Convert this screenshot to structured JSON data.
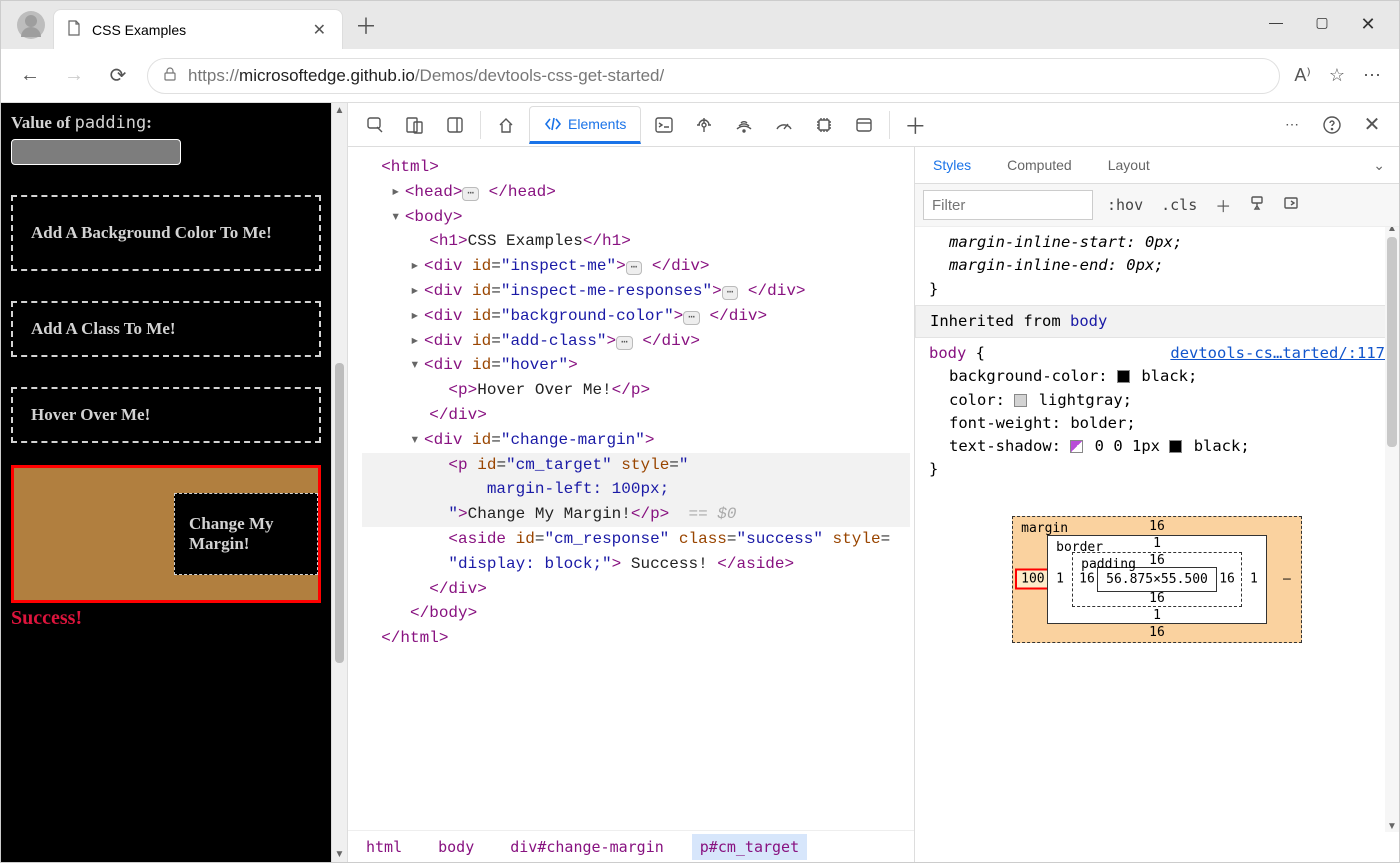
{
  "browser": {
    "tab_title": "CSS Examples",
    "url_prefix": "https://",
    "url_host": "microsoftedge.github.io",
    "url_path": "/Demos/devtools-css-get-started/"
  },
  "page": {
    "padding_label_prefix": "Value of ",
    "padding_label_mono": "padding",
    "padding_label_suffix": ":",
    "box_bgcolor": "Add A Background Color To Me!",
    "box_addclass": "Add A Class To Me!",
    "box_hover": "Hover Over Me!",
    "change_margin": "Change My Margin!",
    "success": "Success!"
  },
  "devtools": {
    "elements_tab": "Elements",
    "styles_tab": "Styles",
    "computed_tab": "Computed",
    "layout_tab": "Layout",
    "filter_placeholder": "Filter",
    "hov": ":hov",
    "cls": ".cls"
  },
  "dom": {
    "l1": "<html>",
    "l2a": "<head>",
    "l2b": "</head>",
    "l3": "<body>",
    "l4a": "<h1>",
    "l4b": "CSS Examples",
    "l4c": "</h1>",
    "l5a": "<div ",
    "l5b": "id",
    "l5c": "\"inspect-me\"",
    "l5d": "</div>",
    "l6c": "\"inspect-me-responses\"",
    "l7c": "\"background-color\"",
    "l8c": "\"add-class\"",
    "l9c": "\"hover\"",
    "l10a": "<p>",
    "l10b": "Hover Over Me!",
    "l10c": "</p>",
    "l11": "</div>",
    "l12c": "\"change-margin\"",
    "l13a": "<p ",
    "l13b": "\"cm_target\"",
    "l13c": "style",
    "l14": "margin-left: 100px;",
    "l15a": "Change My Margin!",
    "l15b": "</p>",
    "l15c": "== $0",
    "l16a": "<aside ",
    "l16b": "\"cm_response\"",
    "l16c": "class",
    "l16d": "\"success\"",
    "l17a": "\"display: block;\"",
    "l17b": "Success!",
    "l17c": "</aside>",
    "l18": "</div>",
    "l19": "</body>",
    "l20": "</html>"
  },
  "crumbs": {
    "a": "html",
    "b": "body",
    "c": "div#change-margin",
    "d": "p#cm_target"
  },
  "rules": {
    "mis": "margin-inline-start: 0px;",
    "mie": "margin-inline-end: 0px;",
    "inh": "Inherited from ",
    "inh_sel": "body",
    "body_sel": "body",
    "src": "devtools-cs…tarted/:117",
    "bg": "background-color:",
    "bg_v": "black;",
    "color": "color:",
    "color_v": "lightgray;",
    "fw": "font-weight:",
    "fw_v": "bolder;",
    "ts": "text-shadow:",
    "ts_v": "0 0 1px",
    "ts_v2": "black;"
  },
  "boxmodel": {
    "margin": "margin",
    "border": "border",
    "padding": "padding",
    "m_top": "16",
    "m_right": "–",
    "m_bottom": "16",
    "m_left": "100",
    "b_top": "1",
    "b_right": "1",
    "b_bottom": "1",
    "b_left": "1",
    "p_top": "16",
    "p_right": "16",
    "p_bottom": "16",
    "p_left": "16",
    "content": "56.875×55.500"
  }
}
